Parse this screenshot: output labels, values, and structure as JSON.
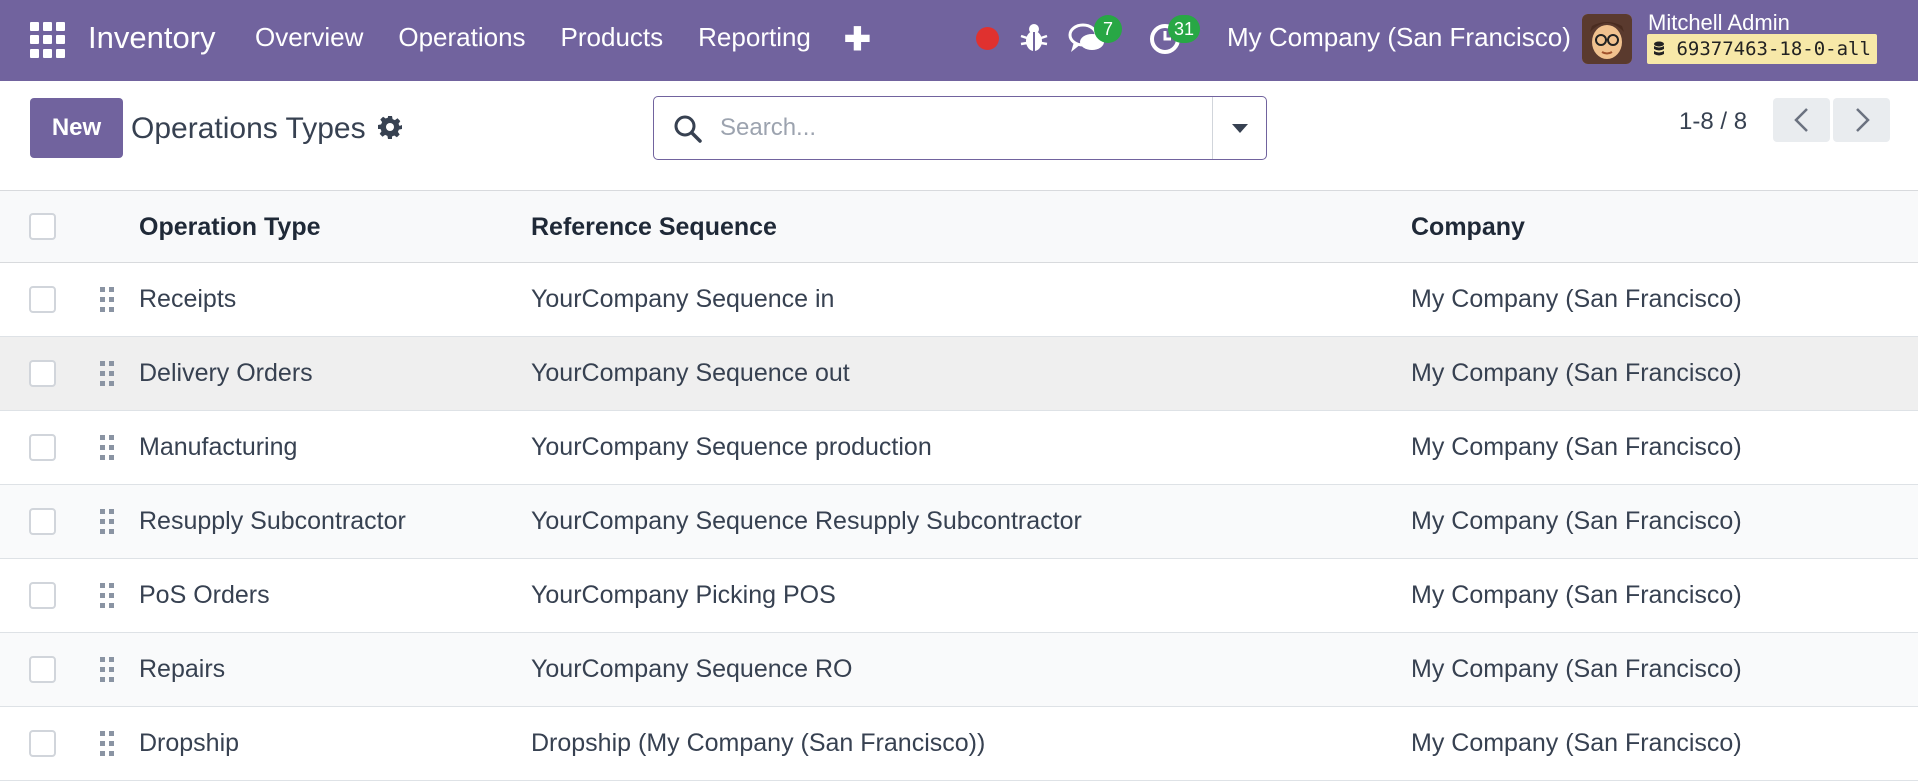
{
  "navbar": {
    "app_name": "Inventory",
    "menu": [
      "Overview",
      "Operations",
      "Products",
      "Reporting"
    ],
    "plus_symbol": "✚",
    "messages_count": "7",
    "activities_count": "31",
    "company": "My Company (San Francisco)",
    "user_name": "Mitchell Admin",
    "database": "69377463-18-0-all",
    "database_icon": "database-icon"
  },
  "control": {
    "new_label": "New",
    "title": "Operations Types",
    "search_placeholder": "Search...",
    "pager": "1-8 / 8"
  },
  "table": {
    "headers": [
      "Operation Type",
      "Reference Sequence",
      "Company"
    ],
    "rows": [
      {
        "type": "Receipts",
        "sequence": "YourCompany Sequence in",
        "company": "My Company (San Francisco)"
      },
      {
        "type": "Delivery Orders",
        "sequence": "YourCompany Sequence out",
        "company": "My Company (San Francisco)"
      },
      {
        "type": "Manufacturing",
        "sequence": "YourCompany Sequence production",
        "company": "My Company (San Francisco)"
      },
      {
        "type": "Resupply Subcontractor",
        "sequence": "YourCompany Sequence Resupply Subcontractor",
        "company": "My Company (San Francisco)"
      },
      {
        "type": "PoS Orders",
        "sequence": "YourCompany Picking POS",
        "company": "My Company (San Francisco)"
      },
      {
        "type": "Repairs",
        "sequence": "YourCompany Sequence RO",
        "company": "My Company (San Francisco)"
      },
      {
        "type": "Dropship",
        "sequence": "Dropship (My Company (San Francisco))",
        "company": "My Company (San Francisco)"
      }
    ]
  },
  "colors": {
    "brand": "#71639e",
    "badge": "#28a745",
    "recording": "#e0312f",
    "db_chip": "#f7e8a8"
  }
}
